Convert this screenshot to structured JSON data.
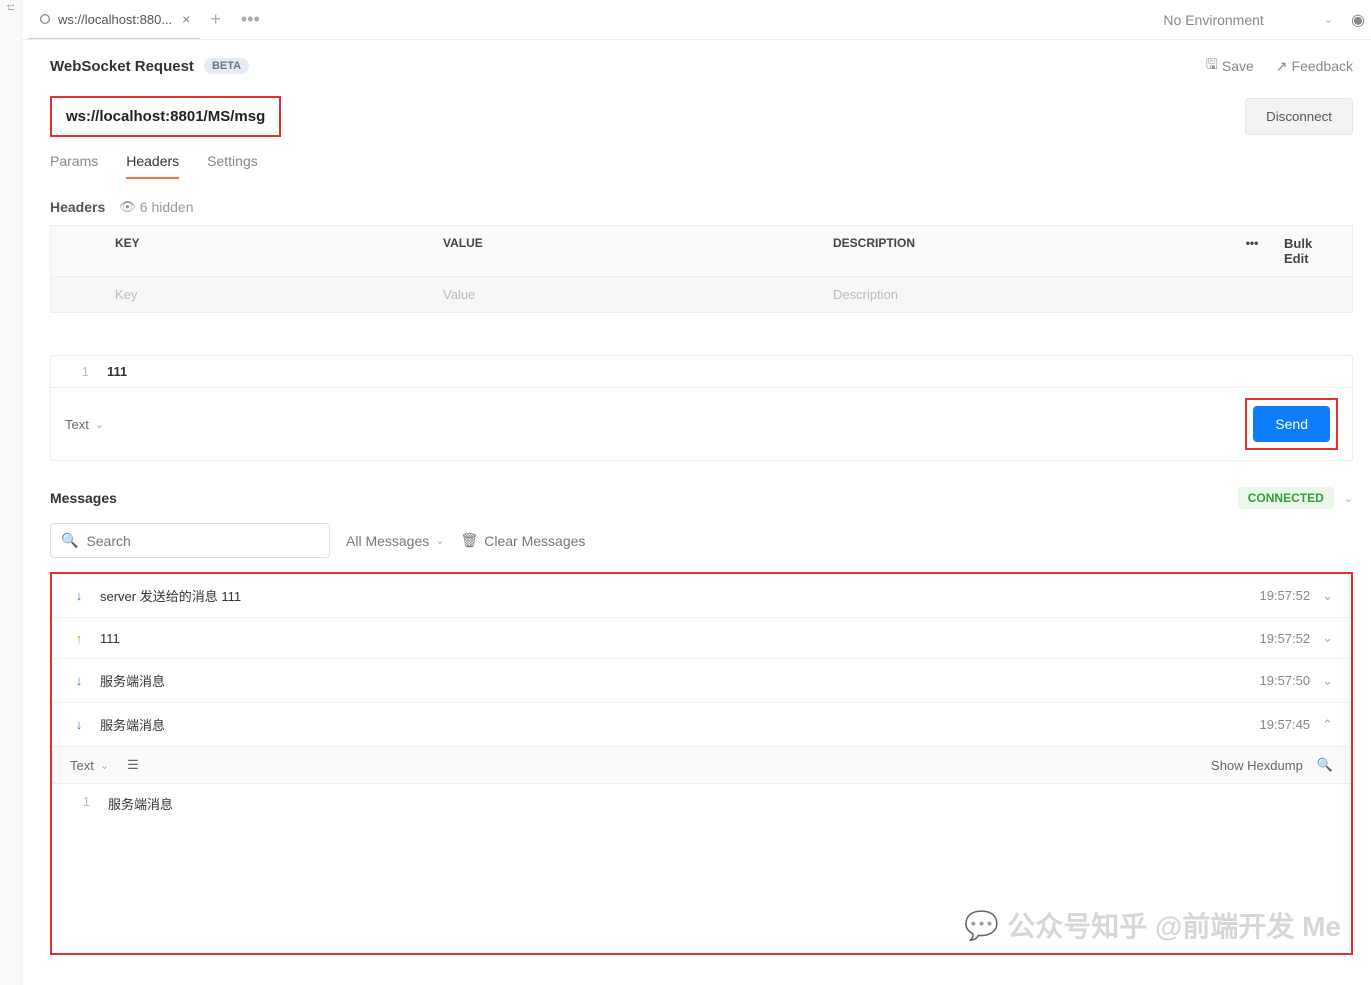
{
  "tab": {
    "title": "ws://localhost:880..."
  },
  "env": {
    "label": "No Environment"
  },
  "request": {
    "title": "WebSocket Request",
    "beta": "BETA",
    "save": "Save",
    "feedback": "Feedback",
    "url": "ws://localhost:8801/MS/msg",
    "disconnect": "Disconnect"
  },
  "subtabs": {
    "params": "Params",
    "headers": "Headers",
    "settings": "Settings"
  },
  "headers_section": {
    "label": "Headers",
    "hidden": "6 hidden",
    "cols": {
      "key": "KEY",
      "value": "VALUE",
      "desc": "DESCRIPTION",
      "bulk": "Bulk Edit"
    },
    "placeholders": {
      "key": "Key",
      "value": "Value",
      "desc": "Description"
    }
  },
  "compose": {
    "line": "1",
    "text": "111",
    "type": "Text",
    "send": "Send"
  },
  "messages": {
    "title": "Messages",
    "connected": "CONNECTED",
    "search_ph": "Search",
    "filter": "All Messages",
    "clear": "Clear Messages",
    "rows": [
      {
        "dir": "down",
        "text": "server 发送给的消息 111",
        "time": "19:57:52",
        "open": false
      },
      {
        "dir": "up",
        "text": "111",
        "time": "19:57:52",
        "open": false
      },
      {
        "dir": "down",
        "text": "服务端消息",
        "time": "19:57:50",
        "open": false
      },
      {
        "dir": "down",
        "text": "服务端消息",
        "time": "19:57:45",
        "open": true
      }
    ],
    "detail": {
      "type": "Text",
      "hex": "Show Hexdump",
      "line": "1",
      "body": "服务端消息"
    }
  },
  "watermark": "公众号知乎 @前端开发 Me"
}
